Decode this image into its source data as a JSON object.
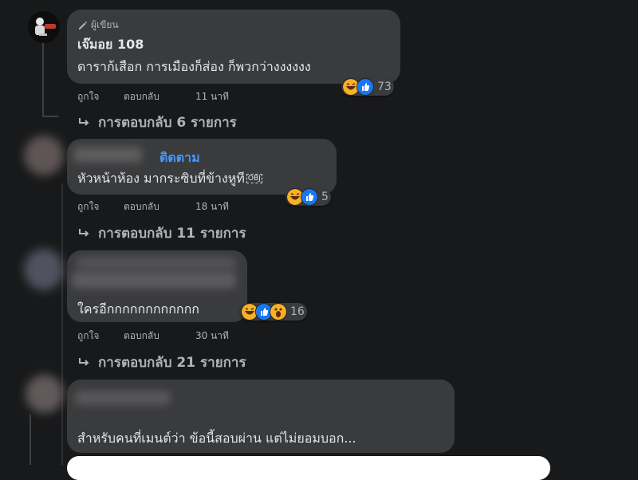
{
  "comments": [
    {
      "badge": "ผู้เขียน",
      "author": "เจ๊มอย 108",
      "text": "ดาราก้เสือก การเมืองก็ส่อง ก็พวกว่างงงงงง",
      "reaction_icons": [
        "haha-icon",
        "like-icon"
      ],
      "reaction_count": "73",
      "actions": [
        "ถูกใจ",
        "ตอบกลับ",
        "11 นาที"
      ],
      "replies": "การตอบกลับ 6 รายการ"
    },
    {
      "follow": "ติดตาม",
      "text": "หัวหน้าห้อง มากระซิบที่ข้างหูที",
      "text_suffix": "OBJ",
      "reaction_icons": [
        "haha-icon",
        "like-icon"
      ],
      "reaction_count": "5",
      "actions": [
        "ถูกใจ",
        "ตอบกลับ",
        "18 นาที"
      ],
      "replies": "การตอบกลับ 11 รายการ"
    },
    {
      "text": "ใครอีกกกกกกกกกกกก",
      "reaction_icons": [
        "haha-icon",
        "like-icon",
        "wow-icon"
      ],
      "reaction_count": "16",
      "actions": [
        "ถูกใจ",
        "ตอบกลับ",
        "30 นาที"
      ],
      "replies": "การตอบกลับ 21 รายการ"
    },
    {
      "text": "สำหรับคนที่เมนต์ว่า ข้อนี้สอบผ่าน แต่ไม่ยอมบอก..."
    }
  ],
  "colors": {
    "background": "#18191a",
    "bubble": "#3a3b3c",
    "link_blue": "#4599ff",
    "muted": "#b0b3b8"
  }
}
